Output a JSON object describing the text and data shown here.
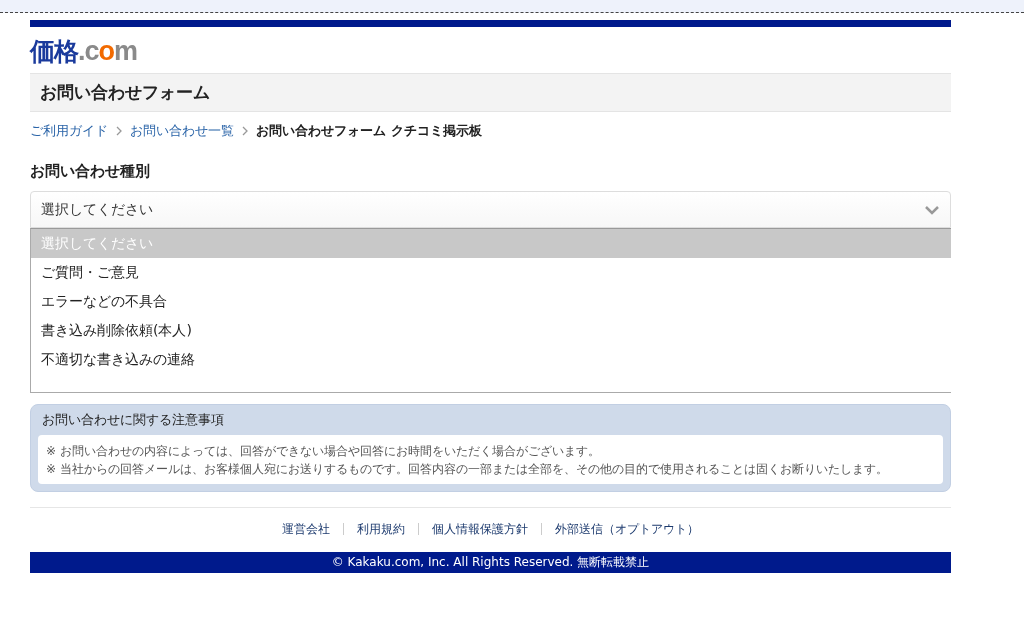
{
  "logo": {
    "parts": [
      {
        "text": "価格",
        "kind": "brand"
      },
      {
        "text": ".c",
        "kind": "plain"
      },
      {
        "text": "o",
        "kind": "accent"
      },
      {
        "text": "m",
        "kind": "plain"
      }
    ]
  },
  "page_title": "お問い合わせフォーム",
  "breadcrumb": [
    {
      "label": "ご利用ガイド",
      "kind": "link"
    },
    {
      "label": "お問い合わせ一覧",
      "kind": "link"
    },
    {
      "label": "お問い合わせフォーム クチコミ掲示板",
      "kind": "current"
    }
  ],
  "section_heading": "お問い合わせ種別",
  "select": {
    "value": "選択してください",
    "expanded": true,
    "options": [
      {
        "label": "選択してください",
        "selected": true
      },
      {
        "label": "ご質問・ご意見",
        "selected": false
      },
      {
        "label": "エラーなどの不具合",
        "selected": false
      },
      {
        "label": "書き込み削除依頼(本人)",
        "selected": false
      },
      {
        "label": "不適切な書き込みの連絡",
        "selected": false
      }
    ]
  },
  "notice": {
    "title": "お問い合わせに関する注意事項",
    "lines": [
      "※ お問い合わせの内容によっては、回答ができない場合や回答にお時間をいただく場合がございます。",
      "※ 当社からの回答メールは、お客様個人宛にお送りするものです。回答内容の一部または全部を、その他の目的で使用されることは固くお断りいたします。"
    ]
  },
  "footer_links": [
    "運営会社",
    "利用規約",
    "個人情報保護方針",
    "外部送信（オプトアウト）"
  ],
  "copyright": "© Kakaku.com, Inc. All Rights Reserved. 無断転載禁止"
}
